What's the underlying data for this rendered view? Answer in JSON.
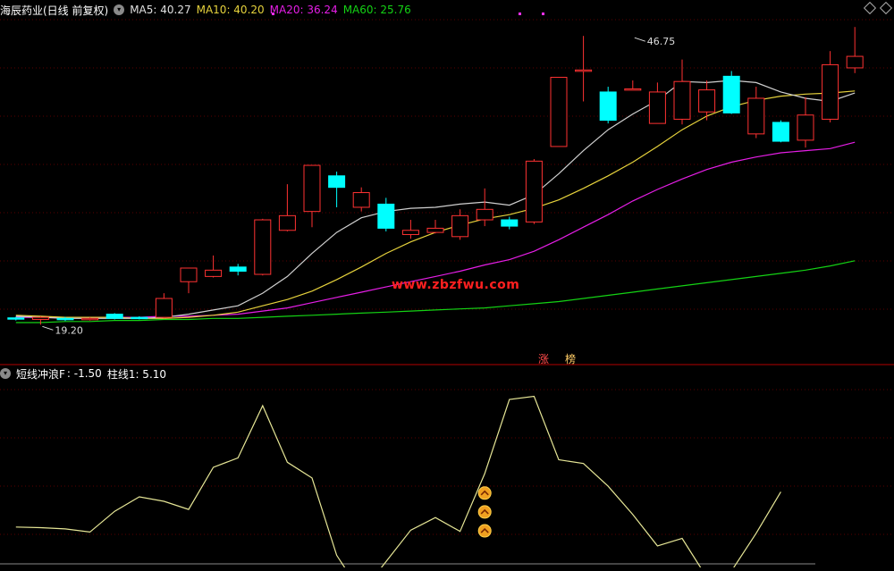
{
  "header": {
    "stock_title": "海辰药业(日线 前复权)",
    "ma5_label": "MA5: 40.27",
    "ma10_label": "MA10: 40.20",
    "ma20_label": "MA20: 36.24",
    "ma60_label": "MA60: 25.76"
  },
  "indicator_header": {
    "name_label": "短线冲浪F",
    "value_label": ": -1.50",
    "column_label": "柱线1: 5.10"
  },
  "watermark": "www.zbzfwu.com",
  "markers": {
    "limit_up": "涨",
    "ranking": "榜"
  },
  "colors": {
    "up": "#ff3232",
    "down": "#00ffff",
    "ma5": "#d0d0d0",
    "ma10": "#e6d23c",
    "ma20": "#e61ee6",
    "ma60": "#14d214",
    "indicator": "#e6e696",
    "grid": "#5a0000",
    "divider": "#b40000"
  },
  "chart_data": [
    {
      "type": "candlestick",
      "annotations": [
        {
          "text": "46.75",
          "price": 46.75,
          "index": 25
        },
        {
          "text": "19.20",
          "price": 19.2,
          "index": 1
        }
      ],
      "price_range": [
        16.5,
        48.3
      ],
      "candles": [
        {
          "o": 19.85,
          "c": 19.75,
          "h": 19.95,
          "l": 19.6
        },
        {
          "o": 19.7,
          "c": 19.9,
          "h": 20.0,
          "l": 19.2
        },
        {
          "o": 19.8,
          "c": 19.7,
          "h": 19.95,
          "l": 19.55
        },
        {
          "o": 19.7,
          "c": 19.8,
          "h": 19.9,
          "l": 19.6
        },
        {
          "o": 20.2,
          "c": 19.8,
          "h": 20.3,
          "l": 19.7
        },
        {
          "o": 19.9,
          "c": 19.85,
          "h": 20.0,
          "l": 19.7
        },
        {
          "o": 19.9,
          "c": 21.7,
          "h": 22.2,
          "l": 19.8
        },
        {
          "o": 23.3,
          "c": 24.6,
          "h": 24.6,
          "l": 22.2
        },
        {
          "o": 23.8,
          "c": 24.4,
          "h": 25.8,
          "l": 23.7
        },
        {
          "o": 24.7,
          "c": 24.3,
          "h": 25.0,
          "l": 23.9
        },
        {
          "o": 24.0,
          "c": 29.2,
          "h": 29.3,
          "l": 23.9
        },
        {
          "o": 28.2,
          "c": 29.6,
          "h": 32.6,
          "l": 28.1
        },
        {
          "o": 30.0,
          "c": 34.4,
          "h": 34.4,
          "l": 28.5
        },
        {
          "o": 33.4,
          "c": 32.3,
          "h": 33.8,
          "l": 30.4
        },
        {
          "o": 30.4,
          "c": 31.8,
          "h": 32.3,
          "l": 30.0
        },
        {
          "o": 30.7,
          "c": 28.4,
          "h": 31.3,
          "l": 28.1
        },
        {
          "o": 27.8,
          "c": 28.2,
          "h": 29.2,
          "l": 27.4
        },
        {
          "o": 28.0,
          "c": 28.4,
          "h": 29.2,
          "l": 27.9
        },
        {
          "o": 27.6,
          "c": 29.6,
          "h": 30.2,
          "l": 27.3
        },
        {
          "o": 29.2,
          "c": 30.2,
          "h": 32.2,
          "l": 28.6
        },
        {
          "o": 29.2,
          "c": 28.6,
          "h": 29.5,
          "l": 28.3
        },
        {
          "o": 29.0,
          "c": 34.8,
          "h": 35.0,
          "l": 28.8
        },
        {
          "o": 36.2,
          "c": 42.8,
          "h": 42.8,
          "l": 36.2
        },
        {
          "o": 43.5,
          "c": 43.5,
          "h": 46.75,
          "l": 40.5
        },
        {
          "o": 41.4,
          "c": 38.7,
          "h": 41.9,
          "l": 38.4
        },
        {
          "o": 41.7,
          "c": 41.7,
          "h": 42.5,
          "l": 41.6
        },
        {
          "o": 38.4,
          "c": 41.4,
          "h": 42.3,
          "l": 38.4
        },
        {
          "o": 38.8,
          "c": 42.4,
          "h": 44.5,
          "l": 38.3
        },
        {
          "o": 39.5,
          "c": 41.6,
          "h": 42.5,
          "l": 38.7
        },
        {
          "o": 42.9,
          "c": 39.4,
          "h": 43.4,
          "l": 39.3
        },
        {
          "o": 37.4,
          "c": 40.8,
          "h": 41.9,
          "l": 37.0
        },
        {
          "o": 38.5,
          "c": 36.7,
          "h": 38.7,
          "l": 36.6
        },
        {
          "o": 36.8,
          "c": 39.2,
          "h": 40.9,
          "l": 36.1
        },
        {
          "o": 38.8,
          "c": 44.0,
          "h": 45.3,
          "l": 38.5
        },
        {
          "o": 43.7,
          "c": 44.8,
          "h": 47.6,
          "l": 43.2
        }
      ],
      "ma5": [
        20.0,
        19.9,
        19.8,
        19.8,
        19.8,
        19.8,
        19.9,
        20.2,
        20.6,
        21.0,
        22.2,
        23.8,
        26.0,
        28.0,
        29.4,
        30.0,
        30.3,
        30.4,
        30.7,
        30.9,
        30.6,
        31.6,
        33.6,
        35.8,
        37.8,
        39.3,
        40.6,
        42.4,
        42.3,
        42.5,
        42.3,
        41.4,
        40.8,
        40.5,
        41.3
      ],
      "ma10": [
        20.1,
        20.0,
        19.9,
        19.9,
        19.9,
        19.8,
        19.8,
        19.9,
        20.1,
        20.4,
        21.0,
        21.6,
        22.4,
        23.5,
        24.7,
        26.0,
        27.1,
        28.0,
        28.7,
        29.3,
        29.7,
        30.3,
        31.1,
        32.2,
        33.4,
        34.7,
        36.2,
        37.8,
        39.1,
        40.0,
        40.6,
        41.0,
        41.2,
        41.3,
        41.5
      ],
      "ma20": [
        19.9,
        19.9,
        19.9,
        19.9,
        19.9,
        19.9,
        20.0,
        20.0,
        20.1,
        20.2,
        20.5,
        20.8,
        21.3,
        21.8,
        22.3,
        22.8,
        23.3,
        23.8,
        24.3,
        24.9,
        25.4,
        26.2,
        27.3,
        28.5,
        29.7,
        31.0,
        32.1,
        33.1,
        34.0,
        34.7,
        35.2,
        35.6,
        35.8,
        36.0,
        36.6
      ],
      "ma60": [
        19.4,
        19.4,
        19.5,
        19.5,
        19.6,
        19.6,
        19.7,
        19.7,
        19.8,
        19.8,
        19.9,
        20.0,
        20.1,
        20.2,
        20.3,
        20.4,
        20.5,
        20.6,
        20.7,
        20.8,
        21.0,
        21.2,
        21.4,
        21.7,
        22.0,
        22.3,
        22.6,
        22.9,
        23.2,
        23.5,
        23.8,
        24.1,
        24.4,
        24.8,
        25.3
      ]
    },
    {
      "type": "line",
      "series": [
        {
          "name": "短线冲浪F",
          "values": [
            -0.5,
            -0.6,
            -0.8,
            -1.3,
            2.0,
            4.3,
            3.6,
            2.3,
            9.0,
            10.5,
            18.8,
            9.8,
            7.3,
            -5.0,
            -11.0,
            -6.0,
            -1.0,
            1.0,
            -1.2,
            8.0,
            19.8,
            20.3,
            10.2,
            9.6,
            6.0,
            1.5,
            -3.5,
            -2.3,
            -8.5,
            -7.5,
            -1.5,
            5.1
          ]
        }
      ],
      "y_range": [
        -6.5,
        22.5
      ],
      "signal_markers": [
        {
          "index": 19,
          "value": 4.9
        },
        {
          "index": 19,
          "value": 1.9
        },
        {
          "index": 19,
          "value": -1.1
        }
      ]
    }
  ]
}
